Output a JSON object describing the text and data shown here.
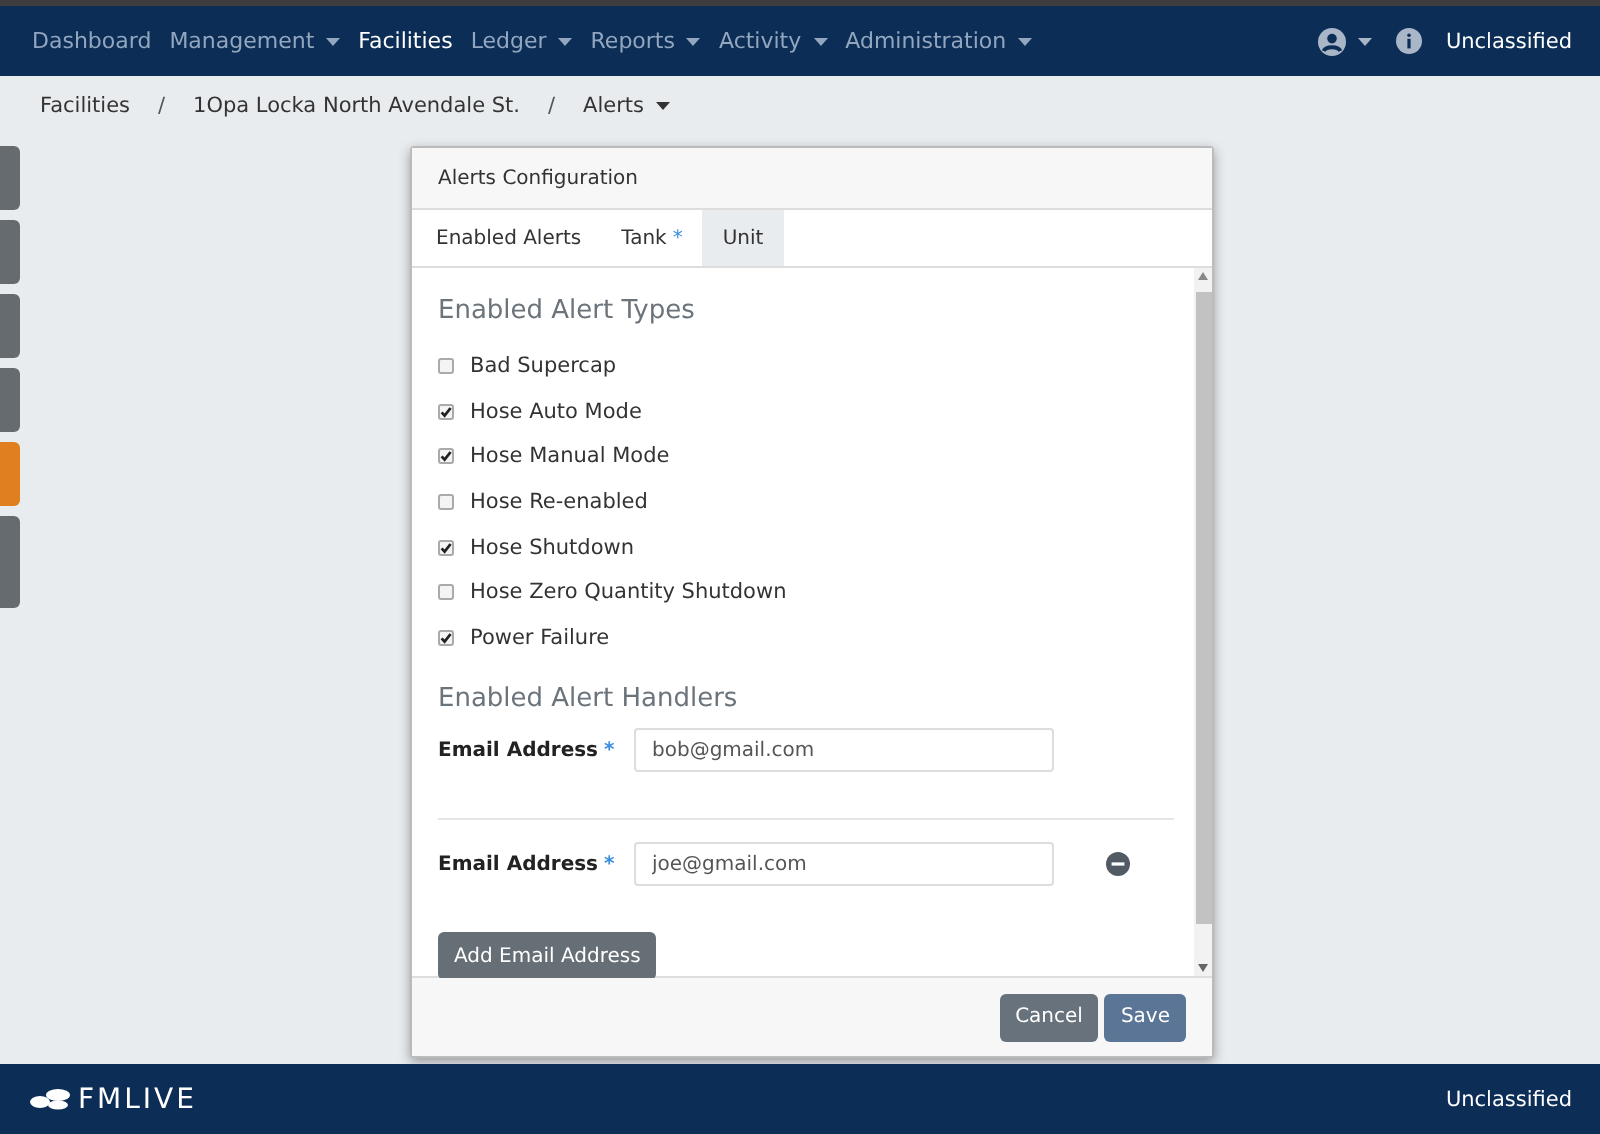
{
  "navbar": {
    "items": [
      {
        "label": "Dashboard",
        "dropdown": false,
        "selected": false
      },
      {
        "label": "Management",
        "dropdown": true,
        "selected": false
      },
      {
        "label": "Facilities",
        "dropdown": false,
        "selected": true
      },
      {
        "label": "Ledger",
        "dropdown": true,
        "selected": false
      },
      {
        "label": "Reports",
        "dropdown": true,
        "selected": false
      },
      {
        "label": "Activity",
        "dropdown": true,
        "selected": false
      },
      {
        "label": "Administration",
        "dropdown": true,
        "selected": false
      }
    ],
    "classification": "Unclassified"
  },
  "breadcrumb": [
    {
      "label": "Facilities",
      "dropdown": false
    },
    {
      "label": "1Opa Locka North Avendale St.",
      "dropdown": false
    },
    {
      "label": "Alerts",
      "dropdown": true
    }
  ],
  "breadcrumb_separator": "/",
  "side_tabs": [
    {
      "selected": false
    },
    {
      "selected": false
    },
    {
      "selected": false
    },
    {
      "selected": false
    },
    {
      "selected": true
    },
    {
      "selected": false
    }
  ],
  "modal": {
    "title": "Alerts Configuration",
    "tabs": [
      {
        "label": "Enabled Alerts",
        "selected": false
      },
      {
        "label": "Tank",
        "required_mark": "*",
        "selected": false
      },
      {
        "label": "Unit",
        "selected": true
      }
    ],
    "alert_types_heading": "Enabled Alert Types",
    "alert_types": [
      {
        "label": "Bad Supercap",
        "checked": false
      },
      {
        "label": "Hose Auto Mode",
        "checked": true
      },
      {
        "label": "Hose Manual Mode",
        "checked": true
      },
      {
        "label": "Hose Re-enabled",
        "checked": false
      },
      {
        "label": "Hose Shutdown",
        "checked": true
      },
      {
        "label": "Hose Zero Quantity Shutdown",
        "checked": false
      },
      {
        "label": "Power Failure",
        "checked": true
      }
    ],
    "handlers_heading": "Enabled Alert Handlers",
    "handlers": [
      {
        "label": "Email Address",
        "required_mark": "*",
        "value": "bob@gmail.com",
        "removable": false
      },
      {
        "label": "Email Address",
        "required_mark": "*",
        "value": "joe@gmail.com",
        "removable": true
      }
    ],
    "add_button": "Add Email Address",
    "buttons": [
      {
        "label": "Cancel",
        "kind": "secondary"
      },
      {
        "label": "Save",
        "kind": "primary"
      }
    ]
  },
  "footer": {
    "brand": "FMLIVE",
    "classification": "Unclassified"
  }
}
